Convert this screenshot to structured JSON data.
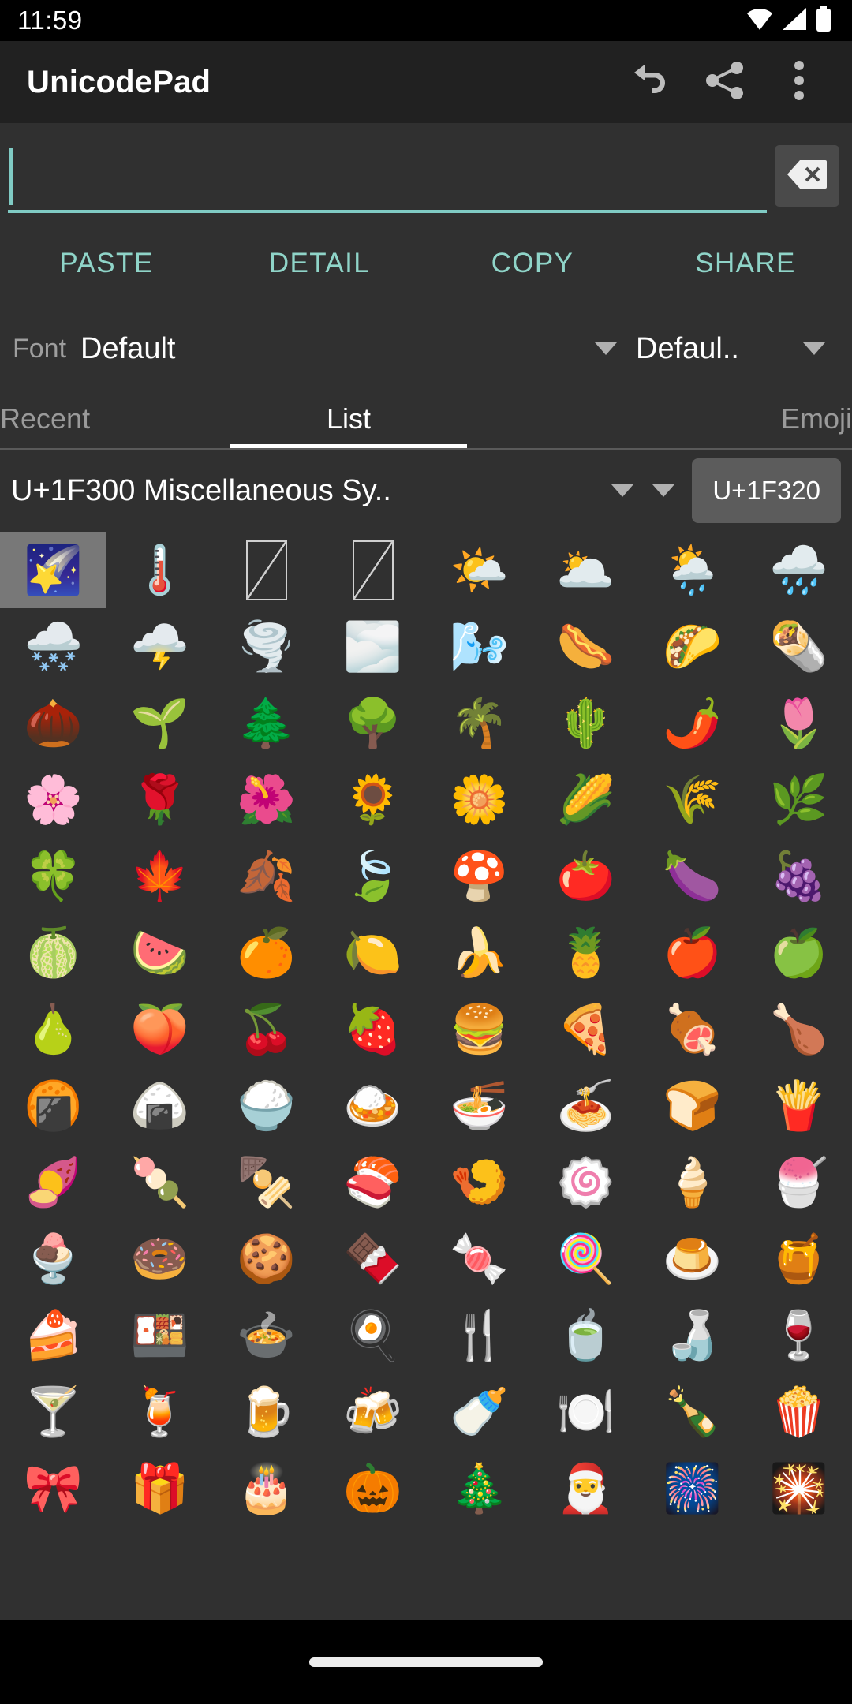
{
  "statusbar": {
    "clock": "11:59",
    "icons": [
      "wifi-icon",
      "signal-icon",
      "battery-icon"
    ]
  },
  "appbar": {
    "title": "UnicodePad",
    "actions": [
      {
        "name": "undo-icon",
        "label": "Undo"
      },
      {
        "name": "share-icon",
        "label": "Share"
      },
      {
        "name": "overflow-menu-icon",
        "label": "More options"
      }
    ]
  },
  "search": {
    "value": "",
    "placeholder": "",
    "clear_icon": "backspace-icon"
  },
  "actions": {
    "paste": "PASTE",
    "detail": "DETAIL",
    "copy": "COPY",
    "share": "SHARE",
    "accent_color": "#8fd4c8"
  },
  "font_row": {
    "label": "Font",
    "family_value": "Default",
    "style_value": "Defaul..",
    "caret_icon": "chevron-down-icon"
  },
  "tabs": [
    {
      "label": "Recent",
      "active": false
    },
    {
      "label": "List",
      "active": true
    },
    {
      "label": "Emoji",
      "active": false
    }
  ],
  "block_selector": {
    "block_name": "U+1F300 Miscellaneous Sy..",
    "caret_icon": "chevron-down-icon",
    "code_button": "U+1F320"
  },
  "grid": {
    "columns": 8,
    "selected_index": 0,
    "selected_codepoint": "U+1F320",
    "cells": [
      {
        "char": "🌠",
        "name": "shooting-star",
        "selected": true
      },
      {
        "char": "🌡️",
        "name": "thermometer",
        "selected": false
      },
      {
        "char": "",
        "name": "missing-glyph",
        "selected": false,
        "tofu": true
      },
      {
        "char": "",
        "name": "missing-glyph",
        "selected": false,
        "tofu": true
      },
      {
        "char": "🌤️",
        "name": "sun-behind-small-cloud",
        "selected": false
      },
      {
        "char": "🌥️",
        "name": "sun-behind-large-cloud",
        "selected": false
      },
      {
        "char": "🌦️",
        "name": "sun-behind-rain-cloud",
        "selected": false
      },
      {
        "char": "🌧️",
        "name": "cloud-with-rain",
        "selected": false
      },
      {
        "char": "🌨️",
        "name": "cloud-with-snow",
        "selected": false
      },
      {
        "char": "🌩️",
        "name": "cloud-with-lightning",
        "selected": false
      },
      {
        "char": "🌪️",
        "name": "tornado",
        "selected": false
      },
      {
        "char": "🌫️",
        "name": "fog",
        "selected": false
      },
      {
        "char": "🌬️",
        "name": "wind-face",
        "selected": false
      },
      {
        "char": "🌭",
        "name": "hot-dog",
        "selected": false
      },
      {
        "char": "🌮",
        "name": "taco",
        "selected": false
      },
      {
        "char": "🌯",
        "name": "burrito",
        "selected": false
      },
      {
        "char": "🌰",
        "name": "chestnut",
        "selected": false
      },
      {
        "char": "🌱",
        "name": "seedling",
        "selected": false
      },
      {
        "char": "🌲",
        "name": "evergreen-tree",
        "selected": false
      },
      {
        "char": "🌳",
        "name": "deciduous-tree",
        "selected": false
      },
      {
        "char": "🌴",
        "name": "palm-tree",
        "selected": false
      },
      {
        "char": "🌵",
        "name": "cactus",
        "selected": false
      },
      {
        "char": "🌶️",
        "name": "hot-pepper",
        "selected": false
      },
      {
        "char": "🌷",
        "name": "tulip",
        "selected": false
      },
      {
        "char": "🌸",
        "name": "cherry-blossom",
        "selected": false
      },
      {
        "char": "🌹",
        "name": "rose",
        "selected": false
      },
      {
        "char": "🌺",
        "name": "hibiscus",
        "selected": false
      },
      {
        "char": "🌻",
        "name": "sunflower",
        "selected": false
      },
      {
        "char": "🌼",
        "name": "blossom",
        "selected": false
      },
      {
        "char": "🌽",
        "name": "ear-of-corn",
        "selected": false
      },
      {
        "char": "🌾",
        "name": "sheaf-of-rice",
        "selected": false
      },
      {
        "char": "🌿",
        "name": "herb",
        "selected": false
      },
      {
        "char": "🍀",
        "name": "four-leaf-clover",
        "selected": false
      },
      {
        "char": "🍁",
        "name": "maple-leaf",
        "selected": false
      },
      {
        "char": "🍂",
        "name": "fallen-leaf",
        "selected": false
      },
      {
        "char": "🍃",
        "name": "leaf-fluttering-in-wind",
        "selected": false
      },
      {
        "char": "🍄",
        "name": "mushroom",
        "selected": false
      },
      {
        "char": "🍅",
        "name": "tomato",
        "selected": false
      },
      {
        "char": "🍆",
        "name": "eggplant",
        "selected": false
      },
      {
        "char": "🍇",
        "name": "grapes",
        "selected": false
      },
      {
        "char": "🍈",
        "name": "melon",
        "selected": false
      },
      {
        "char": "🍉",
        "name": "watermelon",
        "selected": false
      },
      {
        "char": "🍊",
        "name": "tangerine",
        "selected": false
      },
      {
        "char": "🍋",
        "name": "lemon",
        "selected": false
      },
      {
        "char": "🍌",
        "name": "banana",
        "selected": false
      },
      {
        "char": "🍍",
        "name": "pineapple",
        "selected": false
      },
      {
        "char": "🍎",
        "name": "red-apple",
        "selected": false
      },
      {
        "char": "🍏",
        "name": "green-apple",
        "selected": false
      },
      {
        "char": "🍐",
        "name": "pear",
        "selected": false
      },
      {
        "char": "🍑",
        "name": "peach",
        "selected": false
      },
      {
        "char": "🍒",
        "name": "cherries",
        "selected": false
      },
      {
        "char": "🍓",
        "name": "strawberry",
        "selected": false
      },
      {
        "char": "🍔",
        "name": "hamburger",
        "selected": false
      },
      {
        "char": "🍕",
        "name": "pizza",
        "selected": false
      },
      {
        "char": "🍖",
        "name": "meat-on-bone",
        "selected": false
      },
      {
        "char": "🍗",
        "name": "poultry-leg",
        "selected": false
      },
      {
        "char": "🍘",
        "name": "rice-cracker",
        "selected": false
      },
      {
        "char": "🍙",
        "name": "rice-ball",
        "selected": false
      },
      {
        "char": "🍚",
        "name": "cooked-rice",
        "selected": false
      },
      {
        "char": "🍛",
        "name": "curry-rice",
        "selected": false
      },
      {
        "char": "🍜",
        "name": "steaming-bowl",
        "selected": false
      },
      {
        "char": "🍝",
        "name": "spaghetti",
        "selected": false
      },
      {
        "char": "🍞",
        "name": "bread",
        "selected": false
      },
      {
        "char": "🍟",
        "name": "french-fries",
        "selected": false
      },
      {
        "char": "🍠",
        "name": "roasted-sweet-potato",
        "selected": false
      },
      {
        "char": "🍡",
        "name": "dango",
        "selected": false
      },
      {
        "char": "🍢",
        "name": "oden",
        "selected": false
      },
      {
        "char": "🍣",
        "name": "sushi",
        "selected": false
      },
      {
        "char": "🍤",
        "name": "fried-shrimp",
        "selected": false
      },
      {
        "char": "🍥",
        "name": "fish-cake-with-swirl",
        "selected": false
      },
      {
        "char": "🍦",
        "name": "soft-ice-cream",
        "selected": false
      },
      {
        "char": "🍧",
        "name": "shaved-ice",
        "selected": false
      },
      {
        "char": "🍨",
        "name": "ice-cream",
        "selected": false
      },
      {
        "char": "🍩",
        "name": "doughnut",
        "selected": false
      },
      {
        "char": "🍪",
        "name": "cookie",
        "selected": false
      },
      {
        "char": "🍫",
        "name": "chocolate-bar",
        "selected": false
      },
      {
        "char": "🍬",
        "name": "candy",
        "selected": false
      },
      {
        "char": "🍭",
        "name": "lollipop",
        "selected": false
      },
      {
        "char": "🍮",
        "name": "custard",
        "selected": false
      },
      {
        "char": "🍯",
        "name": "honey-pot",
        "selected": false
      },
      {
        "char": "🍰",
        "name": "shortcake",
        "selected": false
      },
      {
        "char": "🍱",
        "name": "bento-box",
        "selected": false
      },
      {
        "char": "🍲",
        "name": "pot-of-food",
        "selected": false
      },
      {
        "char": "🍳",
        "name": "cooking-fried-egg",
        "selected": false
      },
      {
        "char": "🍴",
        "name": "fork-and-knife",
        "selected": false
      },
      {
        "char": "🍵",
        "name": "teacup-without-handle",
        "selected": false
      },
      {
        "char": "🍶",
        "name": "sake",
        "selected": false
      },
      {
        "char": "🍷",
        "name": "wine-glass",
        "selected": false
      },
      {
        "char": "🍸",
        "name": "cocktail-glass",
        "selected": false
      },
      {
        "char": "🍹",
        "name": "tropical-drink",
        "selected": false
      },
      {
        "char": "🍺",
        "name": "beer-mug",
        "selected": false
      },
      {
        "char": "🍻",
        "name": "clinking-beer-mugs",
        "selected": false
      },
      {
        "char": "🍼",
        "name": "baby-bottle",
        "selected": false
      },
      {
        "char": "🍽️",
        "name": "fork-and-knife-with-plate",
        "selected": false
      },
      {
        "char": "🍾",
        "name": "bottle-with-popping-cork",
        "selected": false
      },
      {
        "char": "🍿",
        "name": "popcorn",
        "selected": false
      },
      {
        "char": "🎀",
        "name": "ribbon",
        "selected": false
      },
      {
        "char": "🎁",
        "name": "wrapped-gift",
        "selected": false
      },
      {
        "char": "🎂",
        "name": "birthday-cake",
        "selected": false
      },
      {
        "char": "🎃",
        "name": "jack-o-lantern",
        "selected": false
      },
      {
        "char": "🎄",
        "name": "christmas-tree",
        "selected": false
      },
      {
        "char": "🎅",
        "name": "santa-claus",
        "selected": false
      },
      {
        "char": "🎆",
        "name": "fireworks",
        "selected": false
      },
      {
        "char": "🎇",
        "name": "sparkler",
        "selected": false
      }
    ]
  },
  "navbar": {
    "pill": "home-indicator"
  }
}
